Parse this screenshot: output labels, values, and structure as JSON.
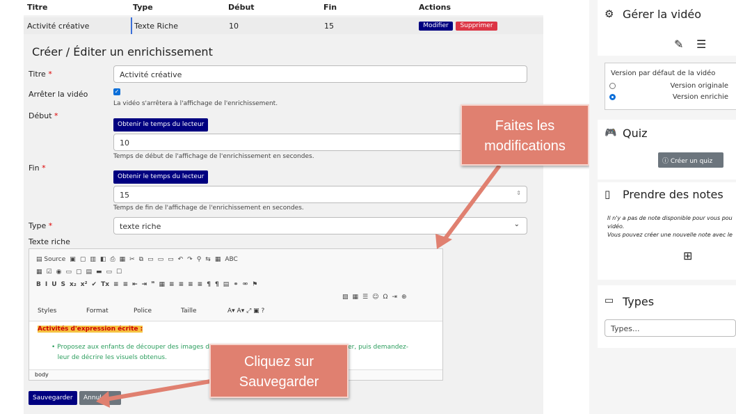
{
  "table": {
    "headers": [
      "Titre",
      "Type",
      "Début",
      "Fin",
      "Actions"
    ],
    "row": {
      "titre": "Activité créative",
      "type": "Texte Riche",
      "debut": "10",
      "fin": "15",
      "modifier": "Modifier",
      "supprimer": "Supprimer"
    }
  },
  "form": {
    "heading": "Créer / Éditer un enrichissement",
    "titre_label": "Titre",
    "titre_value": "Activité créative",
    "stop_label": "Arrêter la vidéo",
    "stop_checked": true,
    "stop_help": "La vidéo s'arrêtera à l'affichage de l'enrichissement.",
    "debut_label": "Début",
    "get_time_label": "Obtenir le temps du lecteur",
    "debut_value": "10",
    "debut_help": "Temps de début de l'affichage de l'enrichissement en secondes.",
    "fin_label": "Fin",
    "fin_value": "15",
    "fin_help": "Temps de fin de l'affichage de l'enrichissement en secondes.",
    "type_label": "Type",
    "type_value": "texte riche",
    "rich_label": "Texte riche",
    "required_mark": "*"
  },
  "editor": {
    "source_label": "Source",
    "styles": "Styles",
    "format": "Format",
    "police": "Police",
    "taille": "Taille",
    "content_heading": "Activités d'expression écrite :",
    "bullet_part1": "Proposez aux enfants de découper des images de mag",
    "bullet_part2": "ner, puis demandez-",
    "bullet_line2": "leur de décrire les visuels obtenus.",
    "status": "body"
  },
  "buttons": {
    "save": "Sauvegarder",
    "cancel": "Annuler"
  },
  "callouts": {
    "modif": "Faites les modifications",
    "save": "Cliquez sur Sauvegarder"
  },
  "sidebar": {
    "manage_title": "Gérer la vidéo",
    "version_title": "Version par défaut de la vidéo",
    "version_options": [
      "Version originale",
      "Version enrichie"
    ],
    "version_selected": "Version enrichie",
    "quiz_title": "Quiz",
    "quiz_button": "Créer un quiz",
    "notes_title": "Prendre des notes",
    "notes_text1": "Il n'y a pas de note disponible pour vous pou",
    "notes_text1b": "vidéo.",
    "notes_text2": "Vous pouvez créer une nouvelle note avec le",
    "types_title": "Types",
    "types_placeholder": "Types..."
  },
  "colors": {
    "primary": "#000080",
    "danger": "#dc3545",
    "callout": "#e08070",
    "accent": "#0b6ed8"
  }
}
